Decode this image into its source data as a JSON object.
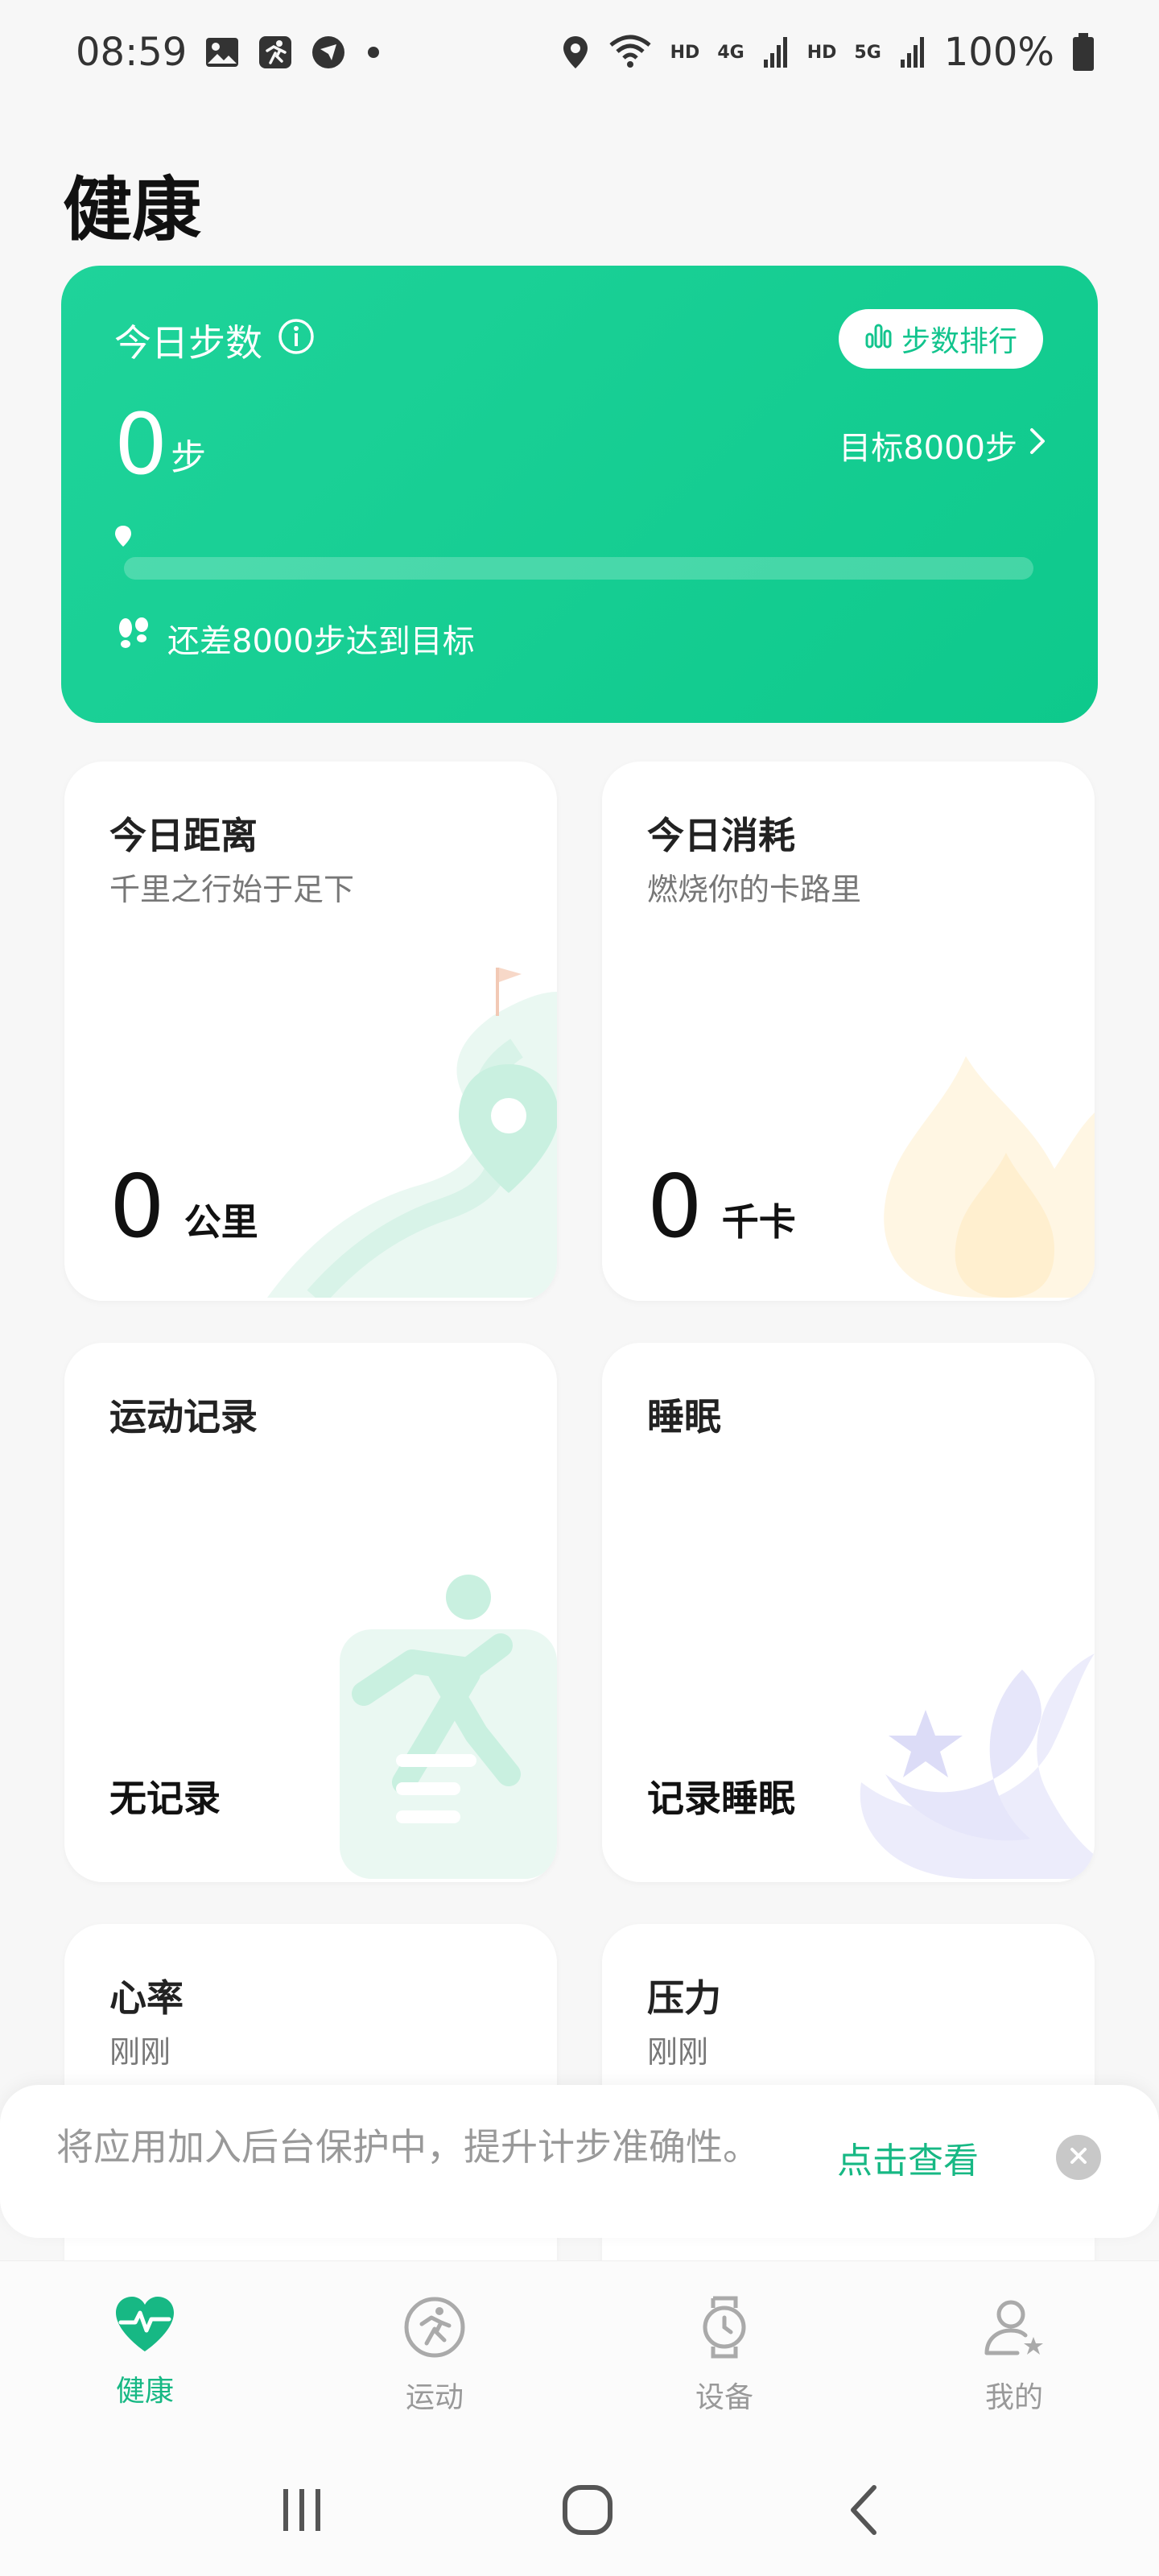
{
  "status_bar": {
    "time": "08:59",
    "hd1": "HD",
    "net1": "4G",
    "hd2": "HD",
    "net2": "5G",
    "battery": "100%"
  },
  "page": {
    "title": "健康"
  },
  "steps": {
    "title": "今日步数",
    "rank_label": "步数排行",
    "value": "0",
    "unit": "步",
    "goal_label": "目标8000步",
    "progress": 0,
    "remaining_label": "还差8000步达到目标"
  },
  "tiles": {
    "distance": {
      "title": "今日距离",
      "subtitle": "千里之行始于足下",
      "value": "0",
      "unit": "公里"
    },
    "calories": {
      "title": "今日消耗",
      "subtitle": "燃烧你的卡路里",
      "value": "0",
      "unit": "千卡"
    },
    "workout": {
      "title": "运动记录",
      "status": "无记录"
    },
    "sleep": {
      "title": "睡眠",
      "status": "记录睡眠"
    },
    "heart_rate": {
      "title": "心率",
      "subtitle": "刚刚"
    },
    "stress": {
      "title": "压力",
      "subtitle": "刚刚"
    }
  },
  "toast": {
    "message": "将应用加入后台保护中，提升计步准确性。",
    "link": "点击查看"
  },
  "bottom_nav": {
    "items": [
      {
        "label": "健康",
        "icon": "heart-pulse-icon"
      },
      {
        "label": "运动",
        "icon": "running-icon"
      },
      {
        "label": "设备",
        "icon": "watch-icon"
      },
      {
        "label": "我的",
        "icon": "user-icon"
      }
    ]
  },
  "colors": {
    "accent": "#17b884",
    "card_green": "#12cc90"
  }
}
